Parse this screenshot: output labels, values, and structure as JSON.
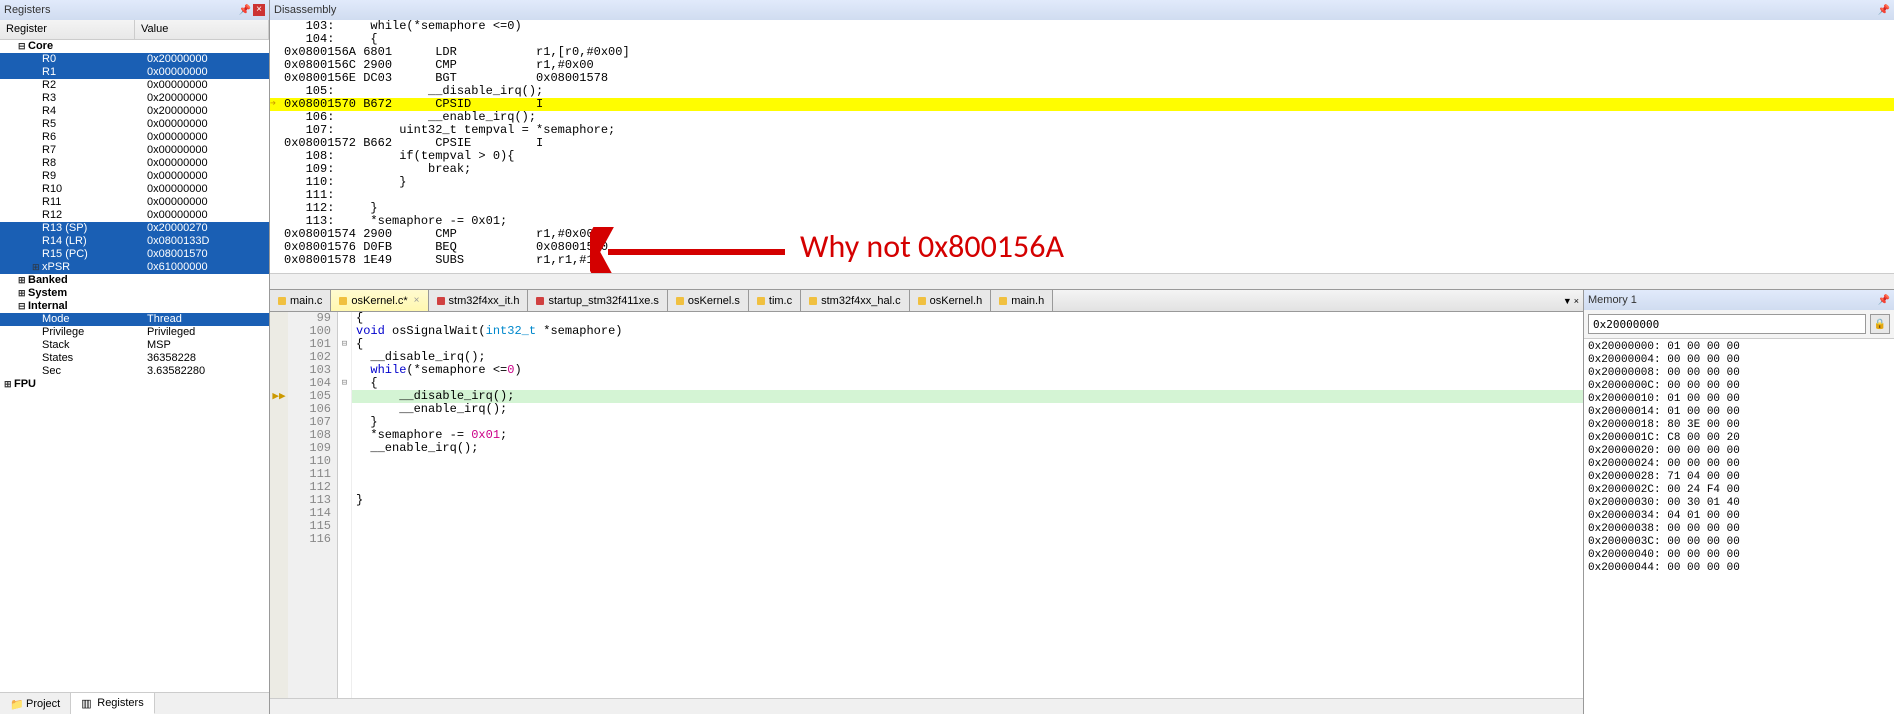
{
  "registers_panel": {
    "title": "Registers",
    "header_register": "Register",
    "header_value": "Value",
    "tree": [
      {
        "name": "Core",
        "lvl": 1,
        "expander": "⊟"
      },
      {
        "name": "R0",
        "val": "0x20000000",
        "lvl": 2,
        "selected": true
      },
      {
        "name": "R1",
        "val": "0x00000000",
        "lvl": 2,
        "selected": true
      },
      {
        "name": "R2",
        "val": "0x00000000",
        "lvl": 2
      },
      {
        "name": "R3",
        "val": "0x20000000",
        "lvl": 2
      },
      {
        "name": "R4",
        "val": "0x20000000",
        "lvl": 2
      },
      {
        "name": "R5",
        "val": "0x00000000",
        "lvl": 2
      },
      {
        "name": "R6",
        "val": "0x00000000",
        "lvl": 2
      },
      {
        "name": "R7",
        "val": "0x00000000",
        "lvl": 2
      },
      {
        "name": "R8",
        "val": "0x00000000",
        "lvl": 2
      },
      {
        "name": "R9",
        "val": "0x00000000",
        "lvl": 2
      },
      {
        "name": "R10",
        "val": "0x00000000",
        "lvl": 2
      },
      {
        "name": "R11",
        "val": "0x00000000",
        "lvl": 2
      },
      {
        "name": "R12",
        "val": "0x00000000",
        "lvl": 2
      },
      {
        "name": "R13 (SP)",
        "val": "0x20000270",
        "lvl": 2,
        "selected": true
      },
      {
        "name": "R14 (LR)",
        "val": "0x0800133D",
        "lvl": 2,
        "selected": true
      },
      {
        "name": "R15 (PC)",
        "val": "0x08001570",
        "lvl": 2,
        "selected": true
      },
      {
        "name": "xPSR",
        "val": "0x61000000",
        "lvl": 2,
        "selected": true,
        "expander": "⊞"
      },
      {
        "name": "Banked",
        "lvl": 1,
        "expander": "⊞"
      },
      {
        "name": "System",
        "lvl": 1,
        "expander": "⊞"
      },
      {
        "name": "Internal",
        "lvl": 1,
        "expander": "⊟"
      },
      {
        "name": "Mode",
        "val": "Thread",
        "lvl": 2,
        "selected": true
      },
      {
        "name": "Privilege",
        "val": "Privileged",
        "lvl": 2
      },
      {
        "name": "Stack",
        "val": "MSP",
        "lvl": 2
      },
      {
        "name": "States",
        "val": "36358228",
        "lvl": 2
      },
      {
        "name": "Sec",
        "val": "3.63582280",
        "lvl": 2
      },
      {
        "name": "FPU",
        "lvl": 0,
        "expander": "⊞"
      }
    ],
    "bottom_tabs": {
      "project": "Project",
      "registers": "Registers"
    }
  },
  "disassembly": {
    "title": "Disassembly",
    "lines": [
      {
        "text": "   103:     while(*semaphore <=0)"
      },
      {
        "text": "   104:     {"
      },
      {
        "text": "0x0800156A 6801      LDR           r1,[r0,#0x00]"
      },
      {
        "text": "0x0800156C 2900      CMP           r1,#0x00"
      },
      {
        "text": "0x0800156E DC03      BGT           0x08001578"
      },
      {
        "text": "   105:             __disable_irq();"
      },
      {
        "text": "0x08001570 B672      CPSID         I",
        "highlight": true,
        "current": true
      },
      {
        "text": "   106:             __enable_irq();"
      },
      {
        "text": "   107:         uint32_t tempval = *semaphore;"
      },
      {
        "text": "0x08001572 B662      CPSIE         I"
      },
      {
        "text": "   108:         if(tempval > 0){"
      },
      {
        "text": "   109:             break;"
      },
      {
        "text": "   110:         }"
      },
      {
        "text": "   111:"
      },
      {
        "text": "   112:     }"
      },
      {
        "text": "   113:     *semaphore -= 0x01;"
      },
      {
        "text": "0x08001574 2900      CMP           r1,#0x00"
      },
      {
        "text": "0x08001576 D0FB      BEQ           0x08001570"
      },
      {
        "text": "0x08001578 1E49      SUBS          r1,r1,#1"
      }
    ]
  },
  "editor": {
    "tabs": [
      {
        "label": "main.c",
        "color": "#f0c040"
      },
      {
        "label": "osKernel.c*",
        "color": "#f0c040",
        "active": true,
        "closeable": true
      },
      {
        "label": "stm32f4xx_it.h",
        "color": "#d04040"
      },
      {
        "label": "startup_stm32f411xe.s",
        "color": "#d04040"
      },
      {
        "label": "osKernel.s",
        "color": "#f0c040"
      },
      {
        "label": "tim.c",
        "color": "#f0c040"
      },
      {
        "label": "stm32f4xx_hal.c",
        "color": "#f0c040"
      },
      {
        "label": "osKernel.h",
        "color": "#f0c040"
      },
      {
        "label": "main.h",
        "color": "#f0c040"
      }
    ],
    "lines": [
      {
        "num": "99",
        "text": "{"
      },
      {
        "num": "100",
        "text": "void osSignalWait(int32_t *semaphore)"
      },
      {
        "num": "101",
        "text": "{",
        "fold": "⊟"
      },
      {
        "num": "102",
        "text": "  __disable_irq();"
      },
      {
        "num": "103",
        "text": "  while(*semaphore <=0)"
      },
      {
        "num": "104",
        "text": "  {",
        "fold": "⊟"
      },
      {
        "num": "105",
        "text": "      __disable_irq();",
        "current": true,
        "arrow": true
      },
      {
        "num": "106",
        "text": "      __enable_irq();"
      },
      {
        "num": "107",
        "text": "  }"
      },
      {
        "num": "108",
        "text": "  *semaphore -= 0x01;",
        "hasNum": true
      },
      {
        "num": "109",
        "text": "  __enable_irq();"
      },
      {
        "num": "110",
        "text": ""
      },
      {
        "num": "111",
        "text": ""
      },
      {
        "num": "112",
        "text": ""
      },
      {
        "num": "113",
        "text": "}"
      },
      {
        "num": "114",
        "text": ""
      },
      {
        "num": "115",
        "text": ""
      },
      {
        "num": "116",
        "text": ""
      }
    ]
  },
  "memory": {
    "title": "Memory 1",
    "address": "0x20000000",
    "lines": [
      "0x20000000: 01 00 00 00",
      "0x20000004: 00 00 00 00",
      "0x20000008: 00 00 00 00",
      "0x2000000C: 00 00 00 00",
      "0x20000010: 01 00 00 00",
      "0x20000014: 01 00 00 00",
      "0x20000018: 80 3E 00 00",
      "0x2000001C: C8 00 00 20",
      "0x20000020: 00 00 00 00",
      "0x20000024: 00 00 00 00",
      "0x20000028: 71 04 00 00",
      "0x2000002C: 00 24 F4 00",
      "0x20000030: 00 30 01 40",
      "0x20000034: 04 01 00 00",
      "0x20000038: 00 00 00 00",
      "0x2000003C: 00 00 00 00",
      "0x20000040: 00 00 00 00",
      "0x20000044: 00 00 00 00"
    ]
  },
  "annotation": {
    "text": "Why not 0x800156A"
  }
}
